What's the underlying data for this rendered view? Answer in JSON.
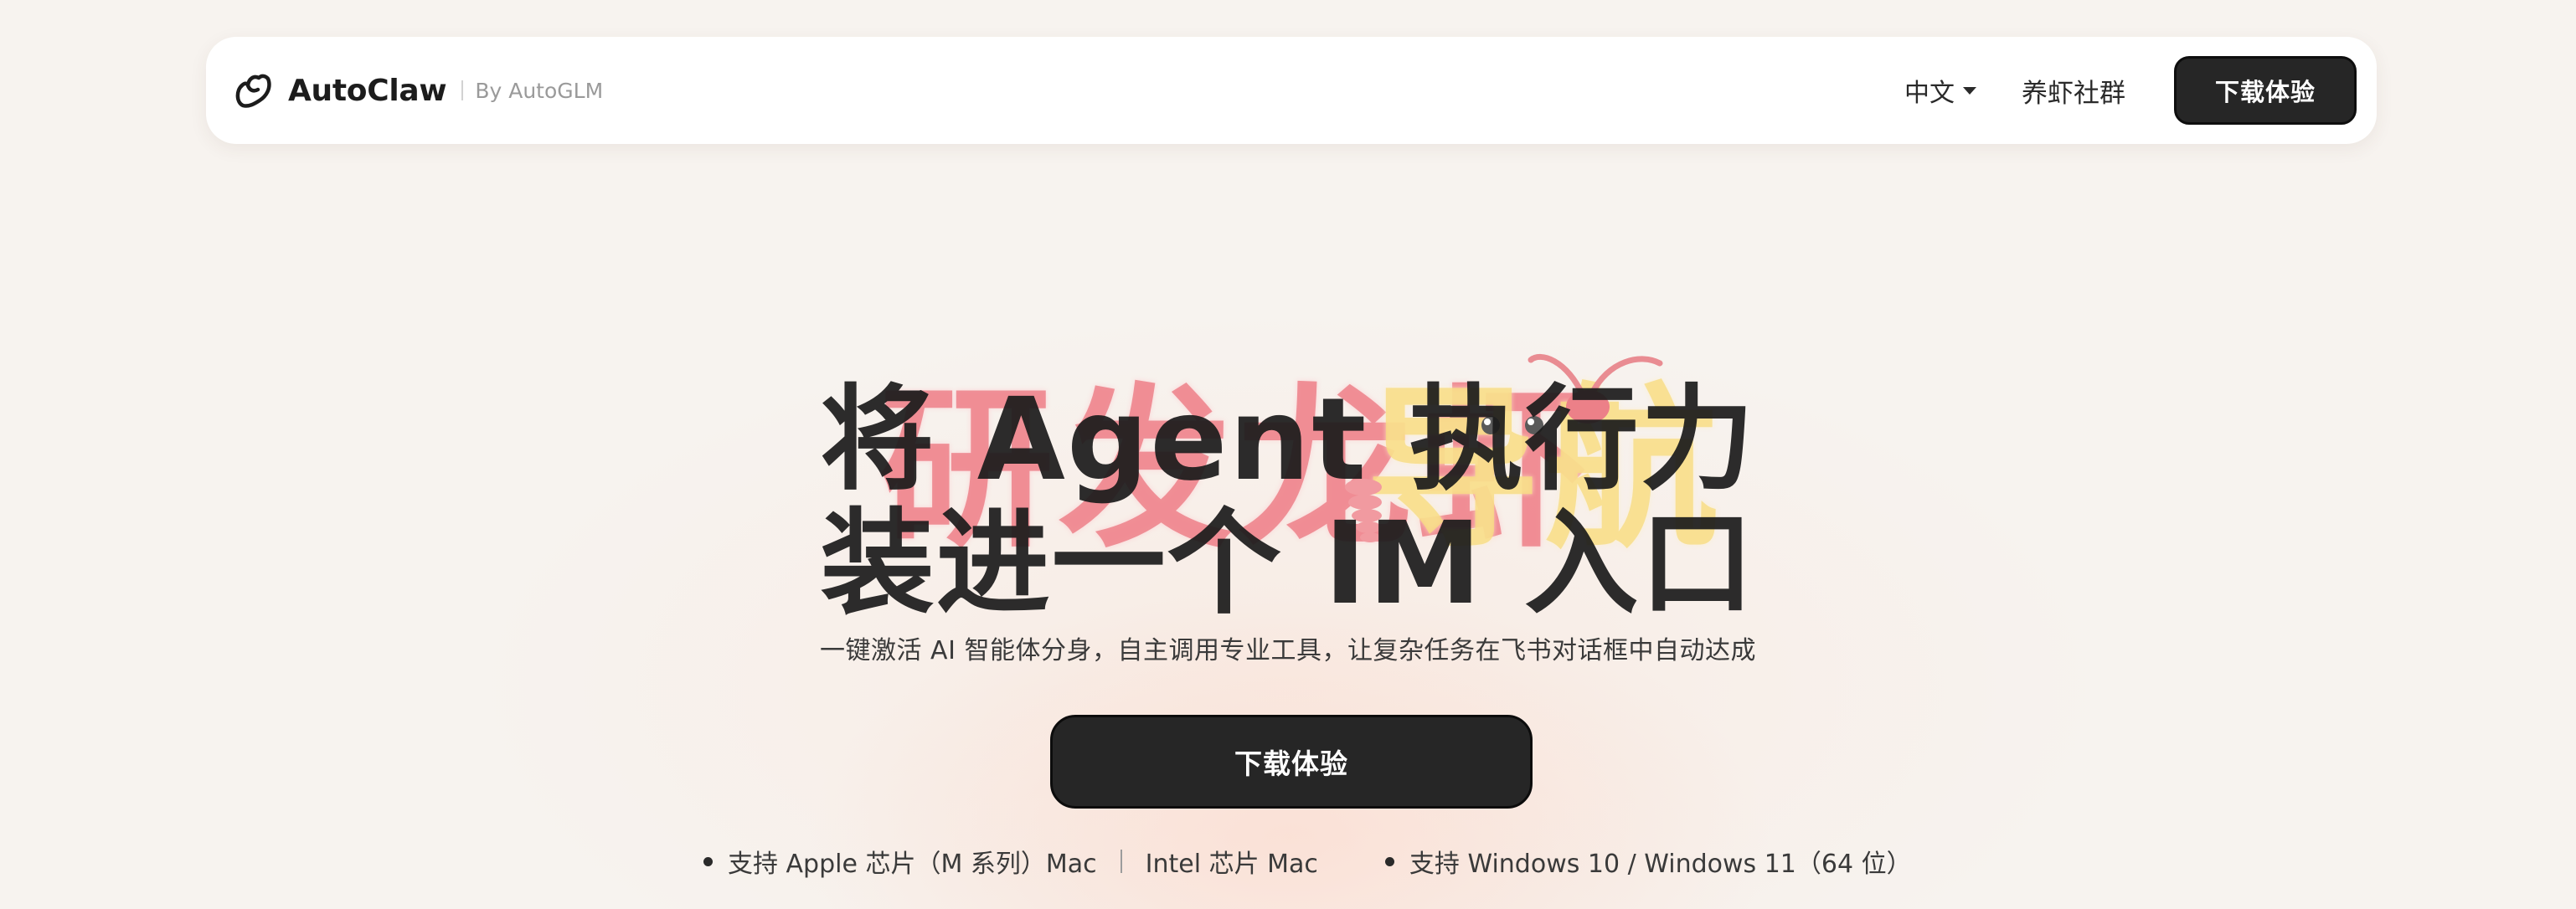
{
  "nav": {
    "brand_name": "AutoClaw",
    "brand_by": "By AutoGLM",
    "language_label": "中文",
    "community_label": "养虾社群",
    "download_label": "下载体验"
  },
  "hero": {
    "art_text_red": "研发龙虾",
    "art_text_yellow": "导航",
    "title_line1": "将 Agent 执行力",
    "title_line2": "装进一个 IM 入口",
    "subtitle": "一键激活 AI 智能体分身，自主调用专业工具，让复杂任务在飞书对话框中自动达成",
    "cta_label": "下载体验"
  },
  "support": {
    "mac_apple": "支持 Apple 芯片（M 系列）Mac",
    "mac_intel": "Intel 芯片 Mac",
    "windows": "支持 Windows 10 / Windows 11（64 位）"
  },
  "colors": {
    "background": "#f7f3ef",
    "button_dark": "#262626",
    "art_red": "#ec7882",
    "art_yellow": "#f7dc82"
  },
  "icons": {
    "brand_logo": "claw-logo-icon",
    "language_caret": "caret-down-icon",
    "bullet": "bullet-dot-icon"
  }
}
